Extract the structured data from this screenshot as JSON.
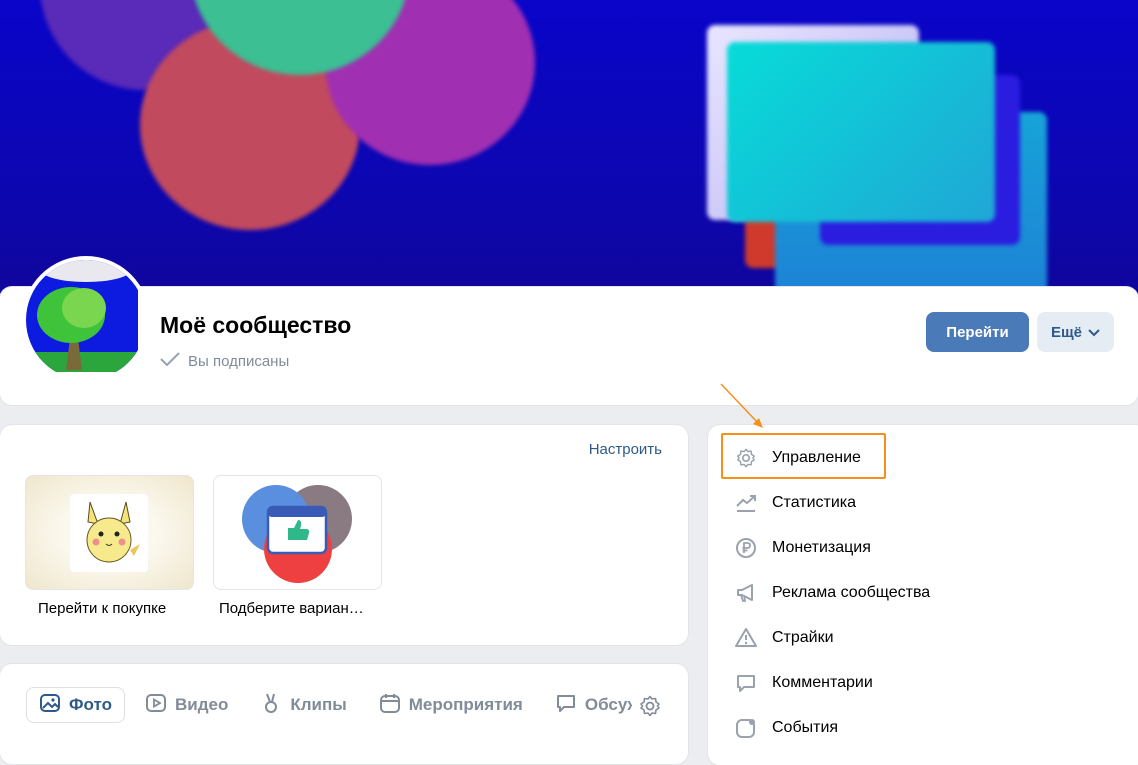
{
  "community": {
    "name": "Моё сообщество",
    "status": "Вы подписаны",
    "primary_button": "Перейти",
    "more_button": "Ещё"
  },
  "widgets": {
    "configure_link": "Настроить",
    "tiles": [
      {
        "caption": "Перейти к покупке"
      },
      {
        "caption": "Подберите вариан…"
      }
    ]
  },
  "content_tabs": [
    {
      "label": "Фото",
      "icon": "photo-icon",
      "active": true
    },
    {
      "label": "Видео",
      "icon": "video-icon",
      "active": false
    },
    {
      "label": "Клипы",
      "icon": "clips-icon",
      "active": false
    },
    {
      "label": "Мероприятия",
      "icon": "calendar-icon",
      "active": false
    },
    {
      "label": "Обсуж",
      "icon": "discussion-icon",
      "active": false
    }
  ],
  "admin_menu": [
    {
      "label": "Управление",
      "icon": "gear-icon",
      "highlighted": true
    },
    {
      "label": "Статистика",
      "icon": "stats-icon"
    },
    {
      "label": "Монетизация",
      "icon": "ruble-icon"
    },
    {
      "label": "Реклама сообщества",
      "icon": "megaphone-icon"
    },
    {
      "label": "Страйки",
      "icon": "warning-icon"
    },
    {
      "label": "Комментарии",
      "icon": "comment-icon"
    },
    {
      "label": "События",
      "icon": "events-icon"
    }
  ],
  "colors": {
    "accent": "#4a7ab8",
    "link": "#2d5a8a",
    "highlight_frame": "#f5901e",
    "muted_text": "#818c99"
  }
}
